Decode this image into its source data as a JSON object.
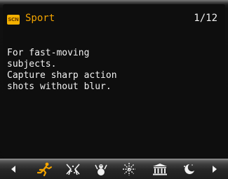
{
  "header": {
    "scene_badge": "SCN",
    "mode_title": "Sport",
    "page_counter": "1/12"
  },
  "description": {
    "lines": [
      "For fast-moving",
      "subjects.",
      "Capture sharp action",
      "shots without blur."
    ]
  },
  "mode_strip": {
    "icons": [
      "left-arrow-icon",
      "sport-runner-icon",
      "indoor-party-icon",
      "snow-icon",
      "fireworks-icon",
      "museum-icon",
      "night-scene-icon",
      "right-arrow-icon"
    ],
    "selected_index": 1,
    "colors": {
      "selected": "#f3a400",
      "unselected": "#f0f0f0"
    }
  },
  "colors": {
    "accent": "#f3a400",
    "badge": "#f3b000",
    "text": "#f2f2f2",
    "background": "#0e0e0e"
  }
}
